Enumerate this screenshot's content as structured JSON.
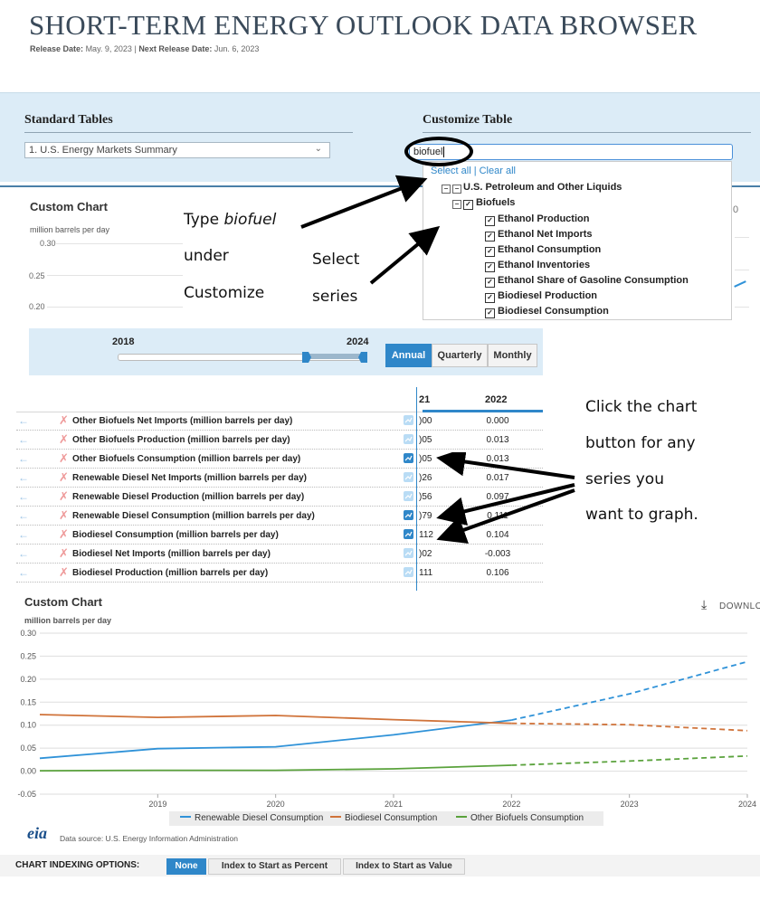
{
  "header": {
    "title": "SHORT-TERM ENERGY OUTLOOK DATA BROWSER",
    "release_label": "Release Date:",
    "release_date": "May. 9, 2023",
    "separator": "|",
    "next_label": "Next Release Date:",
    "next_date": "Jun. 6, 2023"
  },
  "standard_tables": {
    "heading": "Standard Tables",
    "selected": "1. U.S. Energy Markets Summary"
  },
  "customize_table": {
    "heading": "Customize Table",
    "input_value": "biofuel",
    "select_links": "Select all | Clear all",
    "tree": {
      "root": "U.S. Petroleum and Other Liquids",
      "group": "Biofuels",
      "items": [
        "Ethanol Production",
        "Ethanol Net Imports",
        "Ethanol Consumption",
        "Ethanol Inventories",
        "Ethanol Share of Gasoline Consumption",
        "Biodiesel Production",
        "Biodiesel Consumption"
      ]
    }
  },
  "small_chart": {
    "title": "Custom Chart",
    "unit": "million barrels per day",
    "ticks": [
      "0.30",
      "0.25",
      "0.20"
    ],
    "stray_char": "0"
  },
  "annotations": {
    "type_pre": "Type ",
    "type_word": "biofuel",
    "under": "under",
    "customize": "Customize",
    "select": "Select",
    "series": "series",
    "click1": "Click the chart",
    "click2": "button for any",
    "click3": "series you",
    "click4": "want to graph."
  },
  "slider": {
    "start": "2018",
    "end": "2024",
    "buttons": [
      "Annual",
      "Quarterly",
      "Monthly"
    ],
    "active": "Annual"
  },
  "table": {
    "col1": "21",
    "col2": "2022",
    "rows": [
      {
        "label": "Other Biofuels Net Imports (million barrels per day)",
        "v21": ")00",
        "v22": "0.000"
      },
      {
        "label": "Other Biofuels Production (million barrels per day)",
        "v21": ")05",
        "v22": "0.013"
      },
      {
        "label": "Other Biofuels Consumption (million barrels per day)",
        "v21": ")05",
        "v22": "0.013"
      },
      {
        "label": "Renewable Diesel Net Imports (million barrels per day)",
        "v21": ")26",
        "v22": "0.017"
      },
      {
        "label": "Renewable Diesel Production (million barrels per day)",
        "v21": ")56",
        "v22": "0.097"
      },
      {
        "label": "Renewable Diesel Consumption (million barrels per day)",
        "v21": ")79",
        "v22": "0.111"
      },
      {
        "label": "Biodiesel Consumption (million barrels per day)",
        "v21": "112",
        "v22": "0.104"
      },
      {
        "label": "Biodiesel Net Imports (million barrels per day)",
        "v21": ")02",
        "v22": "-0.003"
      },
      {
        "label": "Biodiesel Production (million barrels per day)",
        "v21": "111",
        "v22": "0.106"
      }
    ]
  },
  "custom_chart": {
    "title": "Custom Chart",
    "unit": "million barrels per day",
    "download": "DOWNLOAD",
    "source": "Data source: U.S. Energy Information Administration",
    "logo": "eia"
  },
  "indexing": {
    "label": "CHART INDEXING OPTIONS:",
    "buttons": [
      "None",
      "Index to Start as Percent",
      "Index to Start as Value"
    ],
    "active": "None"
  },
  "colors": {
    "blue": "#2f92d8",
    "orange": "#d0733a",
    "green": "#5aa23c",
    "accent": "#2f87c9"
  },
  "chart_data": {
    "type": "line",
    "title": "Custom Chart",
    "ylabel": "million barrels per day",
    "xlabel": "",
    "ylim": [
      -0.05,
      0.3
    ],
    "xlim": [
      2018,
      2024
    ],
    "yticks": [
      "0.30",
      "0.25",
      "0.20",
      "0.15",
      "0.10",
      "0.05",
      "0.00",
      "-0.05"
    ],
    "xticks": [
      "2019",
      "2020",
      "2021",
      "2022",
      "2023",
      "2024"
    ],
    "grid": true,
    "legend_position": "bottom",
    "forecast_start": 2022,
    "series": [
      {
        "name": "Renewable Diesel Consumption",
        "color": "#2f92d8",
        "x": [
          2018,
          2019,
          2020,
          2021,
          2022,
          2023,
          2024
        ],
        "y": [
          0.028,
          0.049,
          0.053,
          0.079,
          0.111,
          0.168,
          0.238
        ]
      },
      {
        "name": "Biodiesel Consumption",
        "color": "#d0733a",
        "x": [
          2018,
          2019,
          2020,
          2021,
          2022,
          2023,
          2024
        ],
        "y": [
          0.123,
          0.117,
          0.121,
          0.112,
          0.104,
          0.101,
          0.088
        ]
      },
      {
        "name": "Other Biofuels Consumption",
        "color": "#5aa23c",
        "x": [
          2018,
          2019,
          2020,
          2021,
          2022,
          2023,
          2024
        ],
        "y": [
          0.001,
          0.002,
          0.002,
          0.005,
          0.013,
          0.022,
          0.033
        ]
      }
    ]
  }
}
